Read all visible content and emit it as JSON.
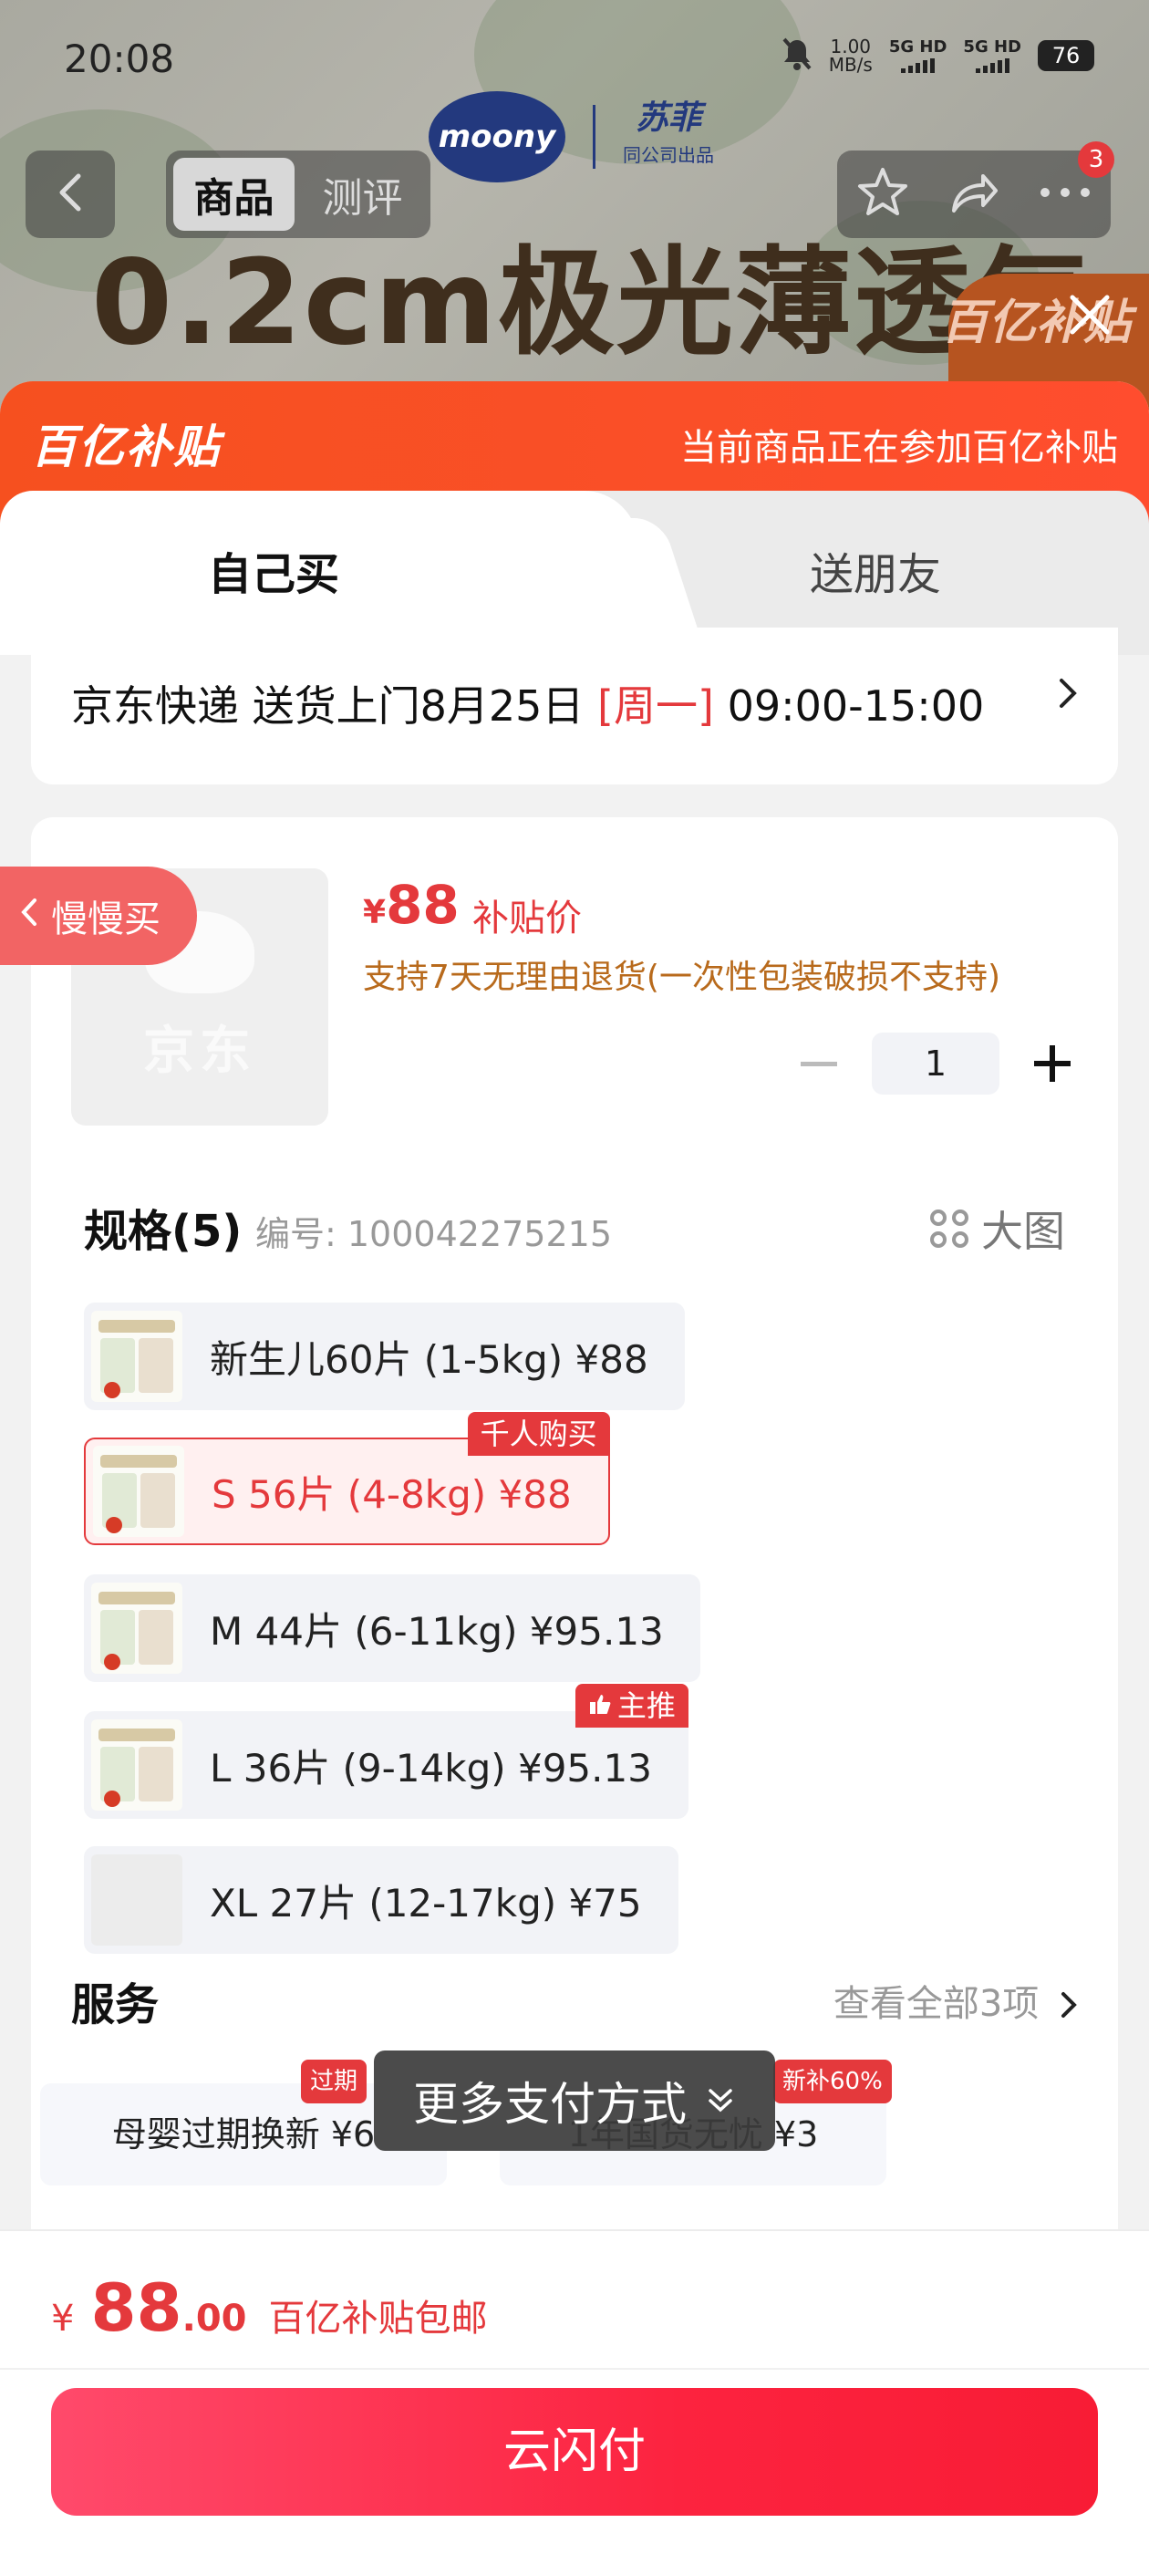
{
  "status_bar": {
    "time": "20:08",
    "net_speed_value": "1.00",
    "net_speed_unit": "MB/s",
    "sim1": "5G HD",
    "sim2": "5G HD",
    "battery": "76"
  },
  "background": {
    "brand_moony": "moony",
    "brand_sofy": "苏菲",
    "brand_sofy_sub": "同公司出品",
    "product_headline": "0.2cm极光薄透气",
    "corner_promo": "百亿补贴"
  },
  "top_nav": {
    "tab_goods": "商品",
    "tab_review": "测评",
    "cart_badge": "3",
    "icons": [
      "back-icon",
      "star-icon",
      "share-icon",
      "more-icon",
      "close-icon"
    ]
  },
  "promo_header": {
    "logo": "百亿补贴",
    "notice": "当前商品正在参加百亿补贴"
  },
  "buy_tabs": {
    "self": "自己买",
    "gift": "送朋友"
  },
  "delivery": {
    "prefix": "京东快递 送货上门8月25日 ",
    "weekday": "[周一]",
    "window": " 09:00-15:00"
  },
  "product": {
    "thumb_text": "京东",
    "price_yen": "¥",
    "price": "88",
    "price_label": "补贴价",
    "return_note": "支持7天无理由退货(一次性包装破损不支持)",
    "quantity": "1"
  },
  "side_tab": {
    "label": "慢慢买"
  },
  "specs": {
    "title": "规格(5)",
    "code": "编号: 100042275215",
    "big_view": "大图",
    "items": [
      {
        "label": "新生儿60片 (1-5kg)  ¥88",
        "tag": ""
      },
      {
        "label": "S 56片 (4-8kg)  ¥88",
        "tag": "千人购买"
      },
      {
        "label": "M 44片 (6-11kg)  ¥95.13",
        "tag": ""
      },
      {
        "label": "L 36片 (9-14kg)  ¥95.13",
        "tag": "主推"
      },
      {
        "label": "XL 27片 (12-17kg)  ¥75",
        "tag": ""
      }
    ],
    "selected_index": 1
  },
  "services": {
    "title": "服务",
    "view_all": "查看全部3项",
    "items": [
      {
        "label": "母婴过期换新  ¥6",
        "badge": "过期"
      },
      {
        "label": "1年国货无忧  ¥3",
        "badge": "新补60%"
      }
    ]
  },
  "toast": {
    "text": "更多支付方式"
  },
  "checkout": {
    "yen": "¥",
    "total_int": "88",
    "total_dec": ".00",
    "note": "百亿补贴包邮",
    "pay_button": "云闪付"
  },
  "colors": {
    "accent_red": "#e4393c",
    "promo_orange": "#f6501f",
    "pay_gradient_start": "#ff4a6b",
    "pay_gradient_end": "#f81c35",
    "return_note": "#b86a1c"
  }
}
